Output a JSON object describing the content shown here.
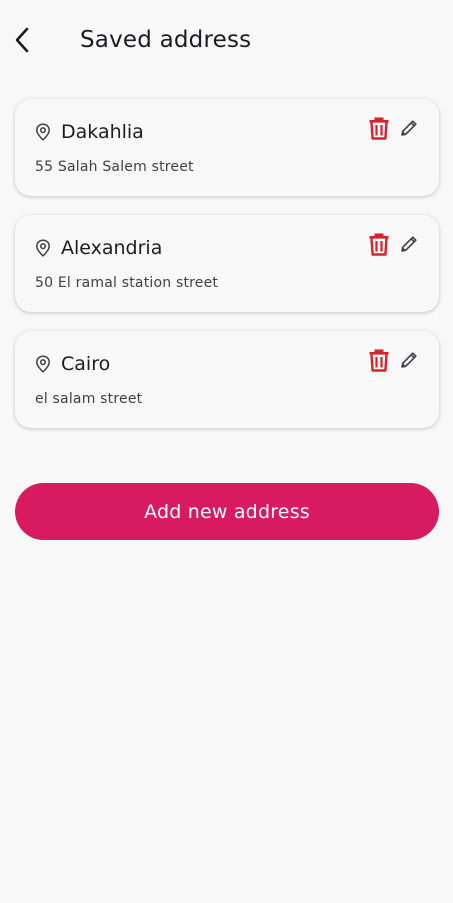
{
  "header": {
    "title": "Saved address",
    "back_icon": "chevron-left-icon"
  },
  "addresses": [
    {
      "city": "Dakahlia",
      "street": "55 Salah Salem street"
    },
    {
      "city": "Alexandria",
      "street": "50 El ramal station street"
    },
    {
      "city": "Cairo",
      "street": "el salam street"
    }
  ],
  "actions": {
    "add_label": "Add new address"
  },
  "icons": {
    "location": "location-pin-icon",
    "delete": "trash-icon",
    "edit": "pencil-icon"
  },
  "colors": {
    "accent": "#d81b60",
    "delete": "#d3222a",
    "background": "#f8f8f8"
  }
}
